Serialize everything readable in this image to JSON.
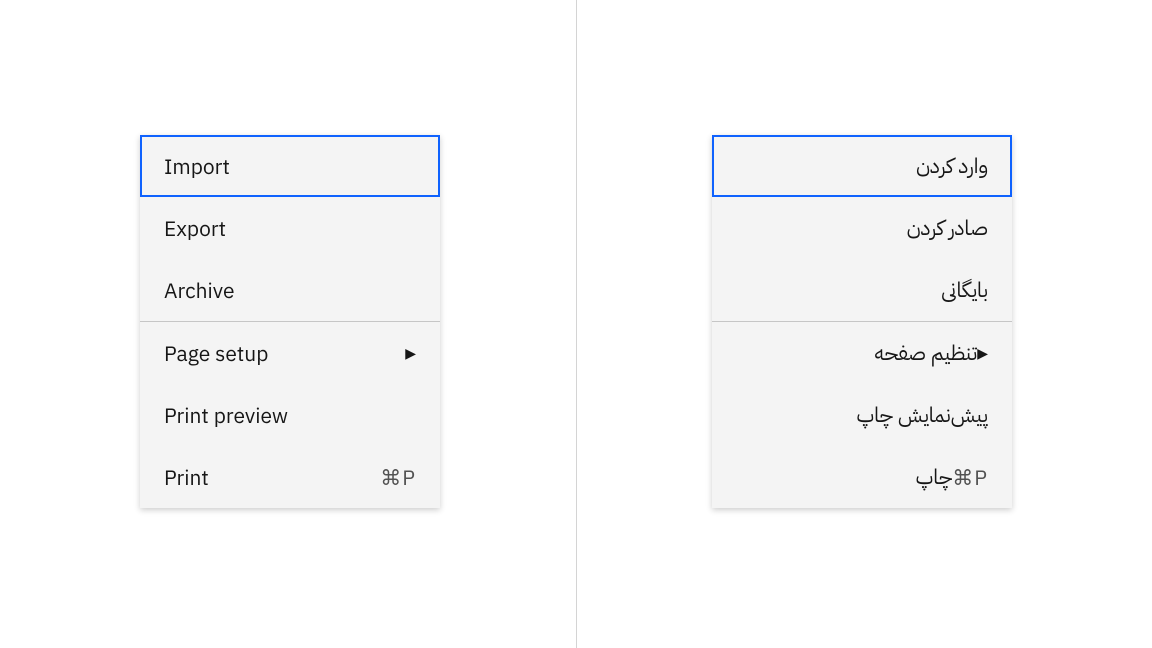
{
  "colors": {
    "selected_outline": "#0f62fe",
    "menu_bg": "#f4f4f4",
    "text": "#161616",
    "shortcut_text": "#525252",
    "separator": "#c6c6c6"
  },
  "menu_ltr": {
    "items": [
      {
        "label": "Import",
        "selected": true
      },
      {
        "label": "Export"
      },
      {
        "label": "Archive"
      },
      {
        "label": "Page setup",
        "has_submenu": true
      },
      {
        "label": "Print preview"
      },
      {
        "label": "Print",
        "shortcut": "⌘P"
      }
    ],
    "arrow_glyph": "▶"
  },
  "menu_rtl": {
    "items": [
      {
        "label": "وارد کردن",
        "selected": true
      },
      {
        "label": "صادر کردن"
      },
      {
        "label": "بایگانی"
      },
      {
        "label": "تنظیم صفحه",
        "has_submenu": true
      },
      {
        "label": "پیش‌نمایش چاپ"
      },
      {
        "label": "چاپ",
        "shortcut": "⌘P"
      }
    ],
    "arrow_glyph": "▶"
  }
}
